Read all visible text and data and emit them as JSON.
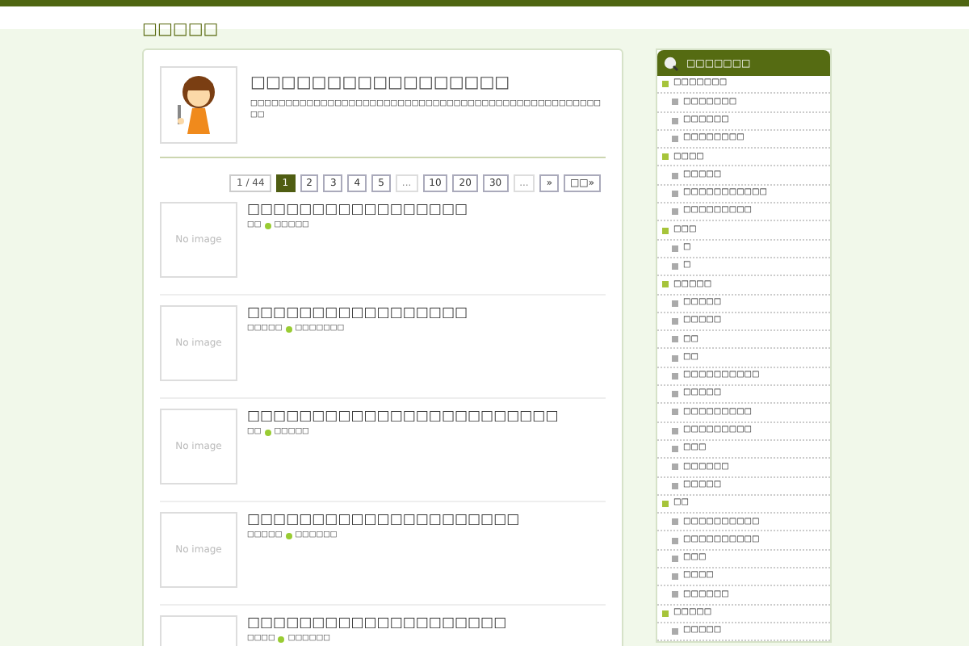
{
  "site_title": "□□□□□",
  "profile": {
    "title": "□□□□□□□□□□□□□□□□□",
    "description": "□□□□□□□□□□□□□□□□□□□□□□□□□□□□□□□□□□□□□□□□□□□□□□□□□□□□"
  },
  "pagination": [
    {
      "label": "1 / 44",
      "kind": "info",
      "selected": false
    },
    {
      "label": "1",
      "kind": "page",
      "selected": true
    },
    {
      "label": "2",
      "kind": "page",
      "selected": false
    },
    {
      "label": "3",
      "kind": "page",
      "selected": false
    },
    {
      "label": "4",
      "kind": "page",
      "selected": false
    },
    {
      "label": "5",
      "kind": "page",
      "selected": false
    },
    {
      "label": "...",
      "kind": "gap",
      "selected": false
    },
    {
      "label": "10",
      "kind": "page",
      "selected": false
    },
    {
      "label": "20",
      "kind": "page",
      "selected": false
    },
    {
      "label": "30",
      "kind": "page",
      "selected": false
    },
    {
      "label": "...",
      "kind": "gap",
      "selected": false
    },
    {
      "label": "»",
      "kind": "page",
      "selected": false
    },
    {
      "label": "□□»",
      "kind": "page",
      "selected": false
    }
  ],
  "posts": [
    {
      "title": "□□□□□□□□□□□□□□□□□",
      "thumbnail": "No image",
      "category": "□□",
      "date": "□□□□□"
    },
    {
      "title": "□□□□□□□□□□□□□□□□□",
      "thumbnail": "No image",
      "category": "□□□□□",
      "date": "□□□□□□□"
    },
    {
      "title": "□□□□□□□□□□□□□□□□□□□□□□□□",
      "thumbnail": "No image",
      "category": "□□",
      "date": "□□□□□"
    },
    {
      "title": "□□□□□□□□□□□□□□□□□□□□□",
      "thumbnail": "No image",
      "category": "□□□□□",
      "date": "□□□□□□"
    },
    {
      "title": "□□□□□□□□□□□□□□□□□□□□",
      "category": "□□□□",
      "date": "□□□□□□"
    }
  ],
  "sidebar": {
    "title": "□□□□□□□",
    "categories": [
      {
        "label": "□□□□□□□",
        "children": [
          {
            "label": "□□□□□□□"
          },
          {
            "label": "□□□□□□"
          },
          {
            "label": "□□□□□□□□"
          }
        ]
      },
      {
        "label": "□□□□",
        "children": [
          {
            "label": "□□□□□"
          },
          {
            "label": "□□□□□□□□□□□"
          },
          {
            "label": "□□□□□□□□□"
          }
        ]
      },
      {
        "label": "□□□",
        "children": [
          {
            "label": "□"
          },
          {
            "label": "□"
          }
        ]
      },
      {
        "label": "□□□□□",
        "children": [
          {
            "label": "□□□□□"
          },
          {
            "label": "□□□□□"
          },
          {
            "label": "□□"
          },
          {
            "label": "□□"
          },
          {
            "label": "□□□□□□□□□□"
          },
          {
            "label": "□□□□□"
          },
          {
            "label": "□□□□□□□□□"
          },
          {
            "label": "□□□□□□□□□"
          },
          {
            "label": "□□□"
          },
          {
            "label": "□□□□□□"
          },
          {
            "label": "□□□□□"
          }
        ]
      },
      {
        "label": "□□",
        "children": [
          {
            "label": "□□□□□□□□□□"
          },
          {
            "label": "□□□□□□□□□□"
          },
          {
            "label": "□□□"
          },
          {
            "label": "□□□□"
          },
          {
            "label": "□□□□□□"
          }
        ]
      },
      {
        "label": "□□□□□",
        "children": [
          {
            "label": "□□□□□"
          }
        ]
      }
    ]
  }
}
